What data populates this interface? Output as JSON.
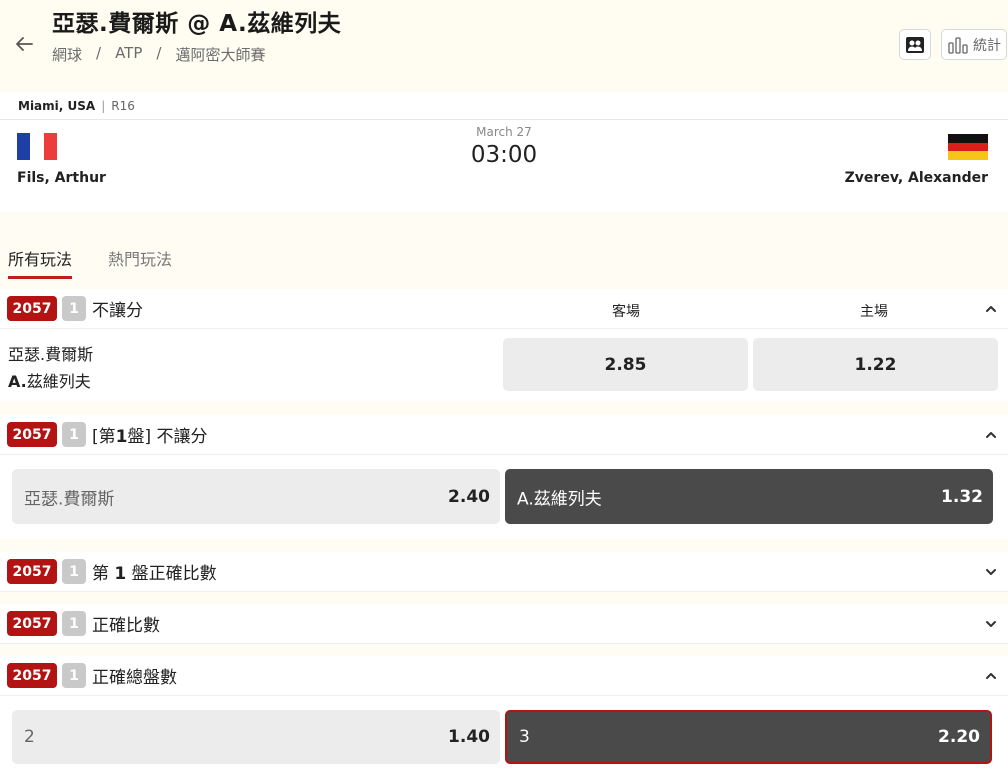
{
  "header": {
    "title": "亞瑟.費爾斯 @ A.茲維列夫",
    "breadcrumb": [
      "網球",
      "ATP",
      "邁阿密大師賽"
    ],
    "stats_label": "統計"
  },
  "match": {
    "city": "Miami, USA",
    "round": "R16",
    "date": "March 27",
    "time": "03:00",
    "player1": "Fils, Arthur",
    "player2": "Zverev, Alexander"
  },
  "tabs": {
    "all": "所有玩法",
    "hot": "熱門玩法"
  },
  "markets": [
    {
      "code": "2057",
      "num": "1",
      "title": "不讓分",
      "col_away": "客場",
      "col_home": "主場",
      "name1": "亞瑟.費爾斯",
      "name2_prefix": "A.",
      "name2_rest": "茲維列夫",
      "odd_away": "2.85",
      "odd_home": "1.22"
    },
    {
      "code": "2057",
      "num": "1",
      "title_bracket": "[第",
      "title_bold": "1",
      "title_end": "盤] 不讓分",
      "opt1_label": "亞瑟.費爾斯",
      "opt1_odd": "2.40",
      "opt2_label": "A.茲維列夫",
      "opt2_odd": "1.32"
    },
    {
      "code": "2057",
      "num": "1",
      "title_pre": "第 ",
      "title_bold": "1",
      "title_post": " 盤正確比數"
    },
    {
      "code": "2057",
      "num": "1",
      "title": "正確比數"
    },
    {
      "code": "2057",
      "num": "1",
      "title": "正確總盤數",
      "opt1_label": "2",
      "opt1_odd": "1.40",
      "opt2_label": "3",
      "opt2_odd": "2.20"
    }
  ]
}
